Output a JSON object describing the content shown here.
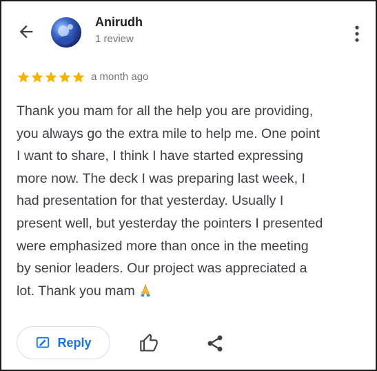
{
  "review": {
    "author": "Anirudh",
    "review_count": "1 review",
    "rating": 5,
    "age": "a month ago",
    "text_lines": [
      "Thank you mam for all the help you are providing,",
      "you always go the extra mile to help me. One point",
      "I want to share, I think I have started expressing",
      "more now. The deck I was preparing last week, I",
      "had presentation for that yesterday. Usually I",
      "present well, but yesterday the pointers I presented",
      "were emphasized more than once in the meeting",
      "by senior leaders. Our project was appreciated a",
      "lot. Thank you mam"
    ]
  },
  "actions": {
    "reply_label": "Reply"
  },
  "icons": {
    "back": "arrow-back-icon",
    "more": "more-vert-icon",
    "star": "star-icon",
    "pray": "folded-hands-icon",
    "reply": "reply-edit-icon",
    "like": "thumb-up-icon",
    "share": "share-icon"
  },
  "colors": {
    "star": "#F4B400",
    "reply_blue": "#1A73E8",
    "text": "#3C4043",
    "secondary": "#70757A"
  }
}
